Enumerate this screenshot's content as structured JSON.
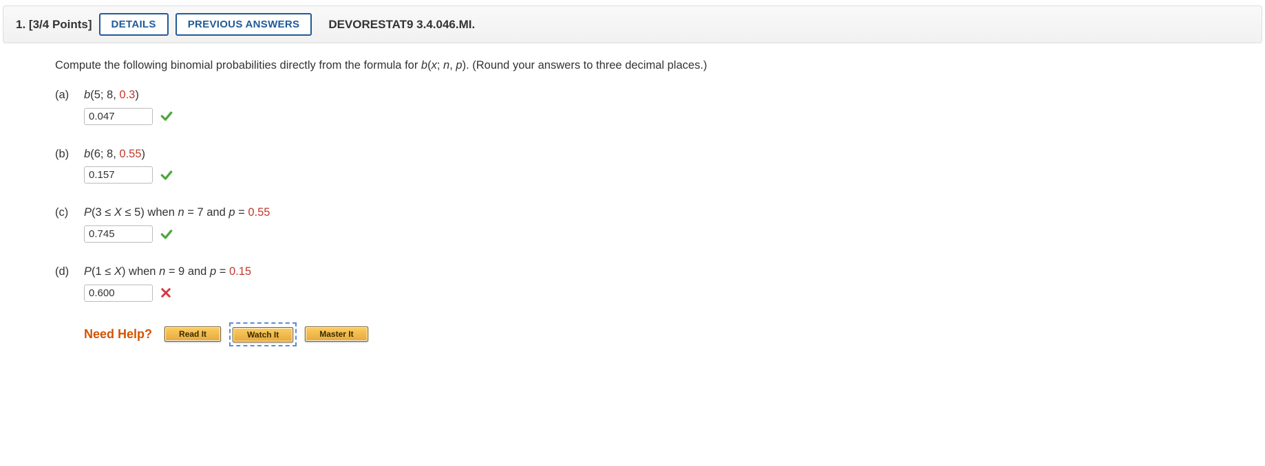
{
  "header": {
    "qnum": "1.",
    "points": "[3/4 Points]",
    "details_btn": "DETAILS",
    "previous_answers_btn": "PREVIOUS ANSWERS",
    "reference": "DEVORESTAT9 3.4.046.MI."
  },
  "instructions": {
    "pre": "Compute the following binomial probabilities directly from the formula for ",
    "func": "b",
    "args_open": "(",
    "arg_x": "x",
    "sep1": "; ",
    "arg_n": "n",
    "sep2": ", ",
    "arg_p": "p",
    "args_close": ")",
    "post": ". (Round your answers to three decimal places.)"
  },
  "parts": {
    "a": {
      "label": "(a)",
      "expr_func": "b",
      "expr_open": "(",
      "expr_v1": "5",
      "sep1": "; ",
      "expr_v2": "8",
      "sep2": ", ",
      "expr_v3": "0.3",
      "expr_close": ")",
      "value": "0.047",
      "status": "correct"
    },
    "b": {
      "label": "(b)",
      "expr_func": "b",
      "expr_open": "(",
      "expr_v1": "6",
      "sep1": "; ",
      "expr_v2": "8",
      "sep2": ", ",
      "expr_v3": "0.55",
      "expr_close": ")",
      "value": "0.157",
      "status": "correct"
    },
    "c": {
      "label": "(c)",
      "expr_pre": "P",
      "expr_open": "(",
      "expr_body1": "3 ≤ ",
      "expr_X": "X",
      "expr_body2": " ≤ 5",
      "expr_close": ")",
      "when": " when ",
      "n_it": "n",
      "eq1": " = 7 and ",
      "p_it": "p",
      "eq2": " = ",
      "pval": "0.55",
      "value": "0.745",
      "status": "correct"
    },
    "d": {
      "label": "(d)",
      "expr_pre": "P",
      "expr_open": "(",
      "expr_body1": "1 ≤ ",
      "expr_X": "X",
      "expr_close": ")",
      "when": " when ",
      "n_it": "n",
      "eq1": " = 9 and ",
      "p_it": "p",
      "eq2": " = ",
      "pval": "0.15",
      "value": "0.600",
      "status": "incorrect"
    }
  },
  "help": {
    "label": "Need Help?",
    "read": "Read It",
    "watch": "Watch It",
    "master": "Master It"
  }
}
